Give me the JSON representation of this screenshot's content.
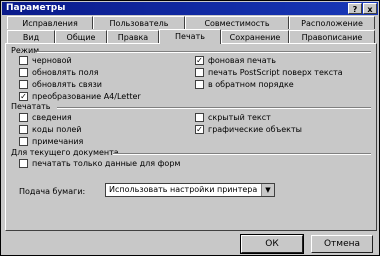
{
  "window": {
    "title": "Параметры",
    "help_label": "?",
    "close_label": "x"
  },
  "tabs_row1": [
    "Исправления",
    "Пользователь",
    "Совместимость",
    "Расположение"
  ],
  "tabs_row2": [
    "Вид",
    "Общие",
    "Правка",
    "Печать",
    "Сохранение",
    "Правописание"
  ],
  "active_tab": "Печать",
  "groups": {
    "mode": "Режим",
    "print": "Печатать",
    "current_doc": "Для текущего документа"
  },
  "mode_options": [
    {
      "label": "черновой",
      "checked": false
    },
    {
      "label": "обновлять поля",
      "checked": false
    },
    {
      "label": "обновлять связи",
      "checked": false
    },
    {
      "label": "преобразование A4/Letter",
      "checked": true
    },
    {
      "label": "фоновая печать",
      "checked": true
    },
    {
      "label": "печать PostScript поверх текста",
      "checked": false
    },
    {
      "label": "в обратном порядке",
      "checked": false
    }
  ],
  "print_options": [
    {
      "label": "сведения",
      "checked": false
    },
    {
      "label": "коды полей",
      "checked": false
    },
    {
      "label": "примечания",
      "checked": false
    },
    {
      "label": "скрытый текст",
      "checked": false
    },
    {
      "label": "графические объекты",
      "checked": true
    }
  ],
  "doc_options": [
    {
      "label": "печатать только данные для форм",
      "checked": false
    }
  ],
  "paper_feed": {
    "label": "Подача бумаги:",
    "value": "Использовать настройки принтера"
  },
  "buttons": {
    "ok": "ОК",
    "cancel": "Отмена"
  }
}
